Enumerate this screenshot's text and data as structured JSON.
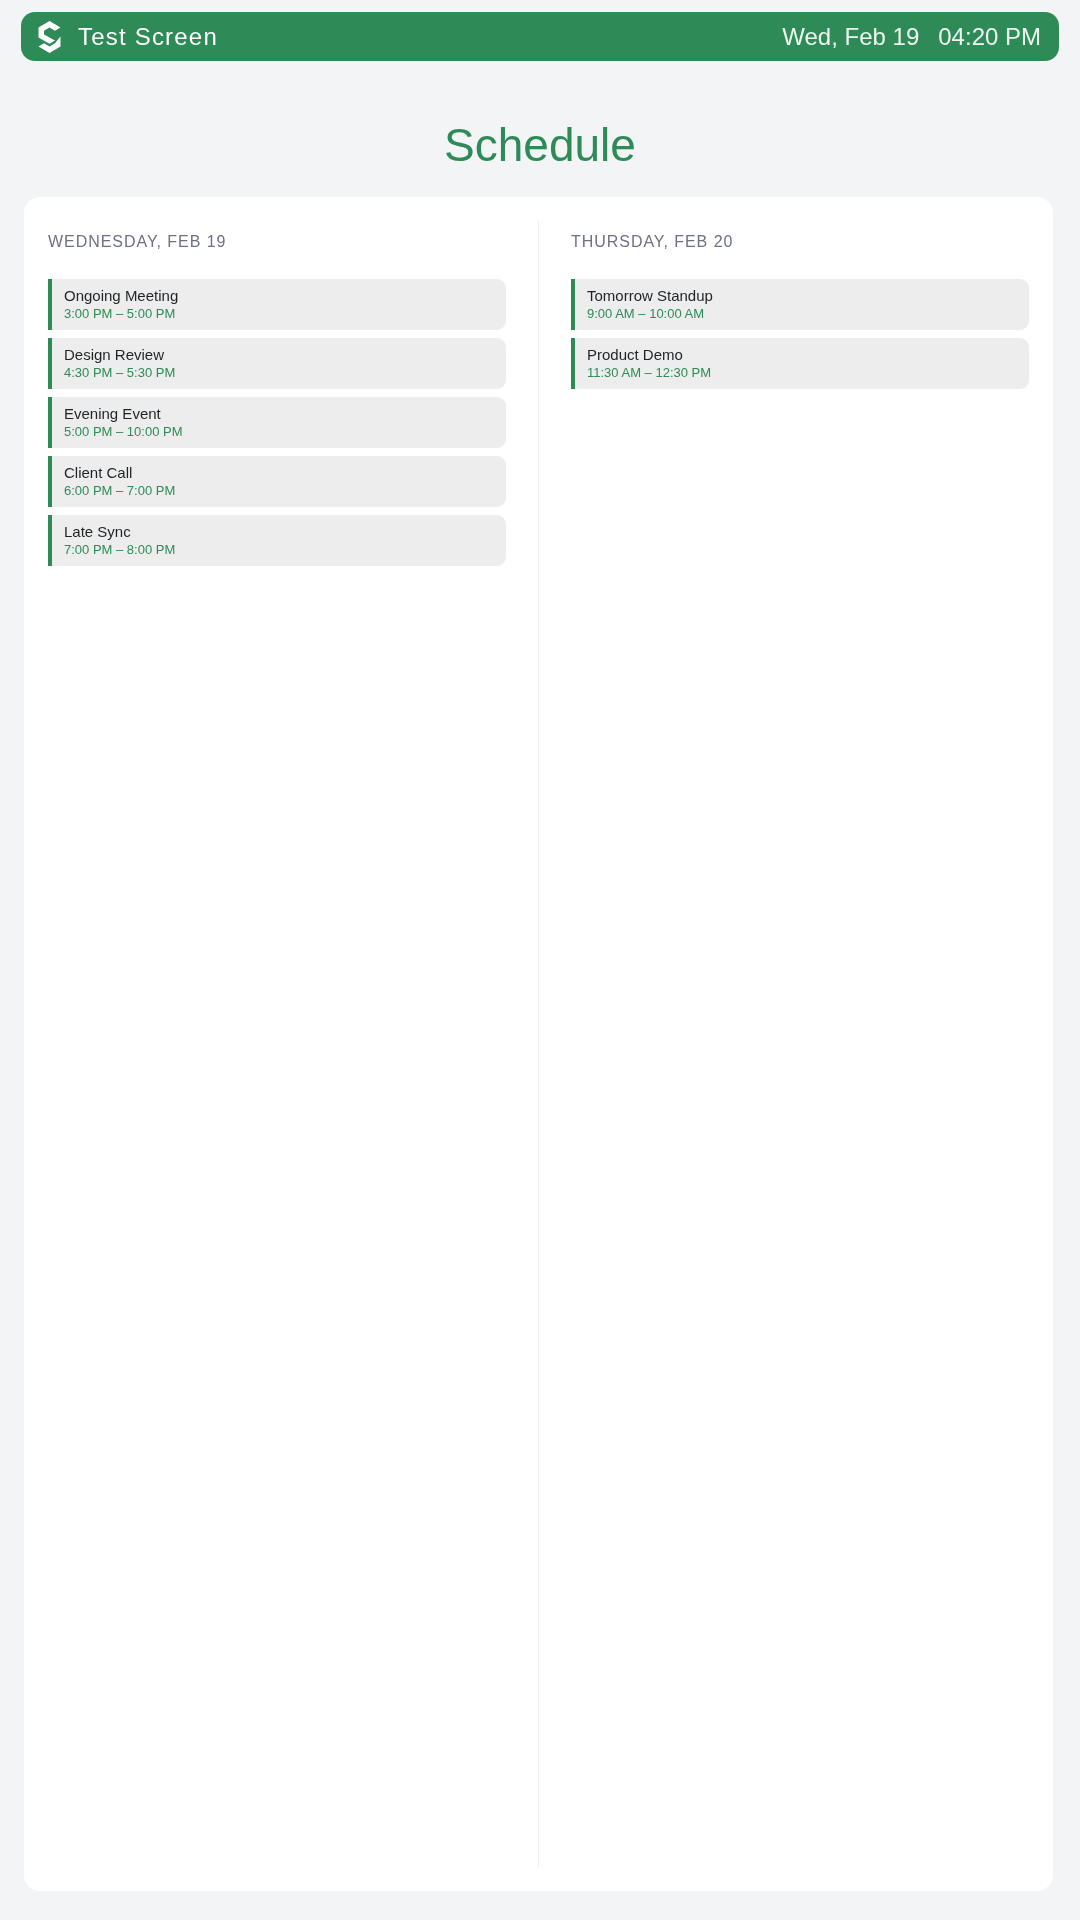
{
  "header": {
    "title": "Test Screen",
    "date": "Wed, Feb 19",
    "time": "04:20 PM"
  },
  "page_title": "Schedule",
  "days": [
    {
      "heading": "WEDNESDAY, FEB 19",
      "events": [
        {
          "title": "Ongoing Meeting",
          "time": "3:00 PM – 5:00 PM"
        },
        {
          "title": "Design Review",
          "time": "4:30 PM – 5:30 PM"
        },
        {
          "title": "Evening Event",
          "time": "5:00 PM – 10:00 PM"
        },
        {
          "title": "Client Call",
          "time": "6:00 PM – 7:00 PM"
        },
        {
          "title": "Late Sync",
          "time": "7:00 PM – 8:00 PM"
        }
      ]
    },
    {
      "heading": "THURSDAY, FEB 20",
      "events": [
        {
          "title": "Tomorrow Standup",
          "time": "9:00 AM – 10:00 AM"
        },
        {
          "title": "Product Demo",
          "time": "11:30 AM – 12:30 PM"
        }
      ]
    }
  ]
}
